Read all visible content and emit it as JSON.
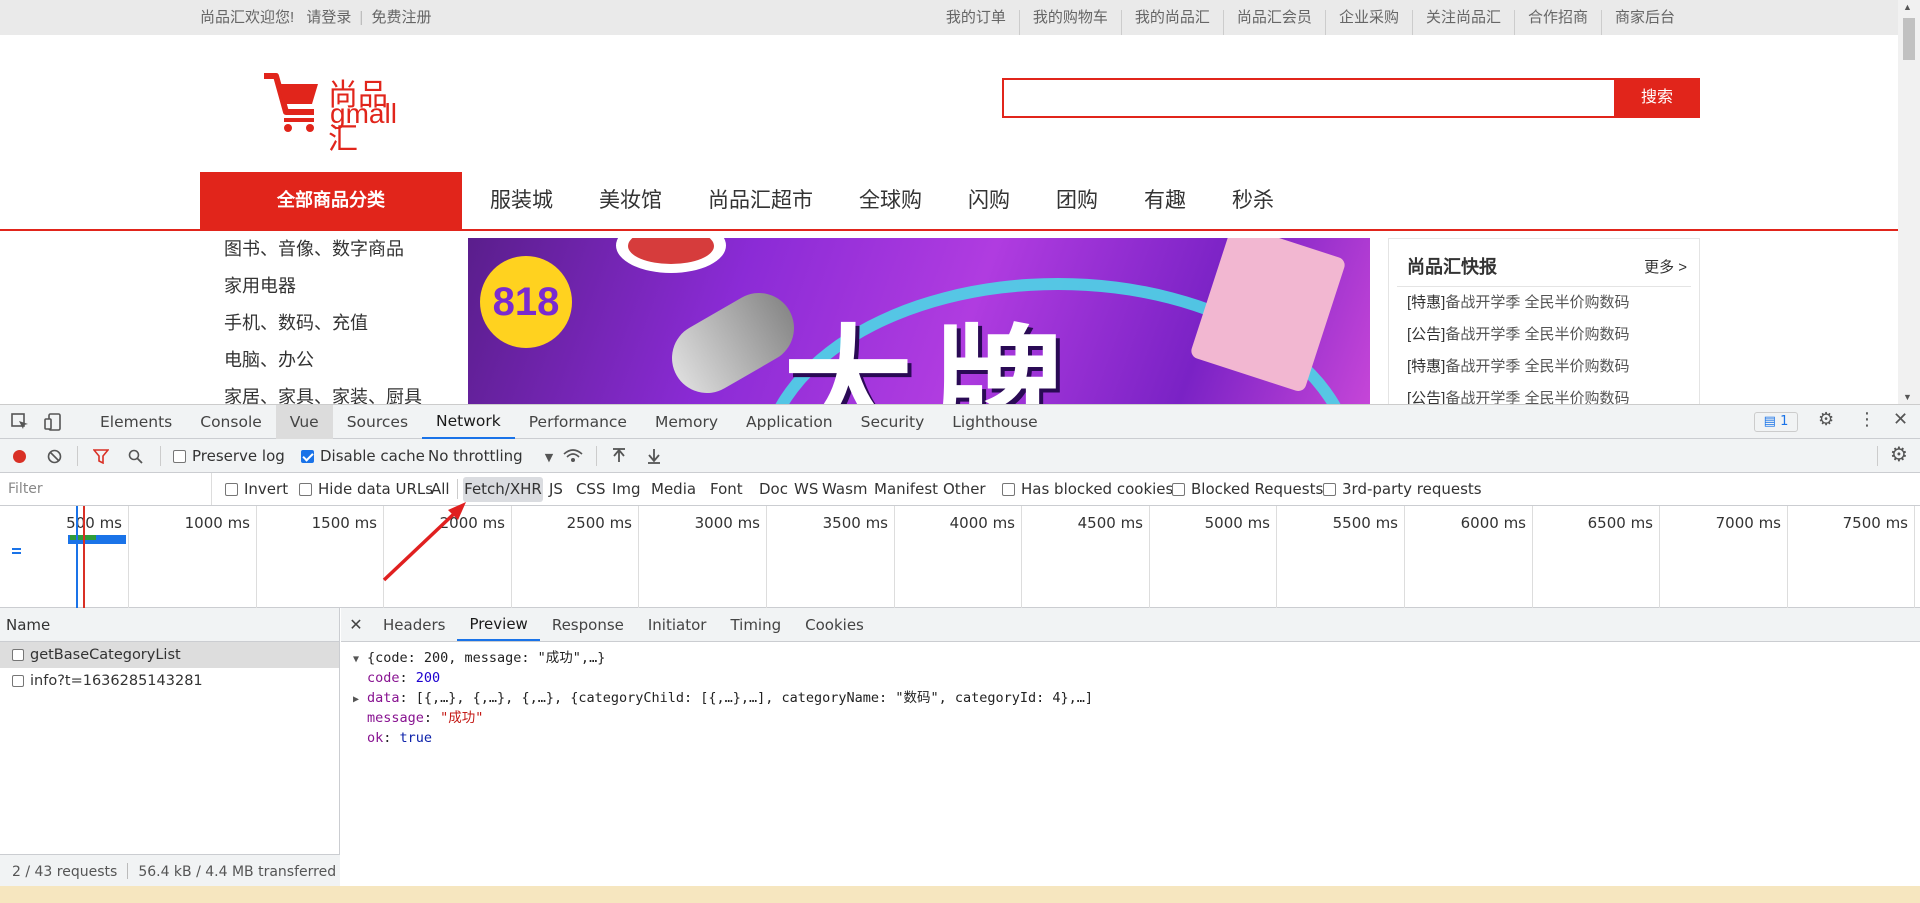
{
  "site": {
    "topbar": {
      "welcome": "尚品汇欢迎您!",
      "login": "请登录",
      "register": "免费注册",
      "links": [
        "我的订单",
        "我的购物车",
        "我的尚品汇",
        "尚品汇会员",
        "企业采购",
        "关注尚品汇",
        "合作招商",
        "商家后台"
      ]
    },
    "logo": {
      "cn": "尚品汇",
      "en": "gmall"
    },
    "search": {
      "value": "",
      "button": "搜索"
    },
    "nav": {
      "all_categories": "全部商品分类",
      "links": [
        "服装城",
        "美妆馆",
        "尚品汇超市",
        "全球购",
        "闪购",
        "团购",
        "有趣",
        "秒杀"
      ]
    },
    "categories": [
      "图书、音像、数字商品",
      "家用电器",
      "手机、数码、充值",
      "电脑、办公",
      "家居、家具、家装、厨具"
    ],
    "banner": {
      "badge": "818",
      "headline": "大牌"
    },
    "news": {
      "title": "尚品汇快报",
      "more": "更多 >",
      "items": [
        {
          "tag": "[特惠]",
          "text": "备战开学季 全民半价购数码"
        },
        {
          "tag": "[公告]",
          "text": "备战开学季 全民半价购数码"
        },
        {
          "tag": "[特惠]",
          "text": "备战开学季 全民半价购数码"
        },
        {
          "tag": "[公告]",
          "text": "备战开学季 全民半价购数码"
        }
      ]
    }
  },
  "devtools": {
    "tabs": [
      "Elements",
      "Console",
      "Vue",
      "Sources",
      "Network",
      "Performance",
      "Memory",
      "Application",
      "Security",
      "Lighthouse"
    ],
    "active_tab": "Network",
    "message_count": "1",
    "toolbar": {
      "preserve_log": "Preserve log",
      "disable_cache": "Disable cache",
      "throttling": "No throttling"
    },
    "filter": {
      "placeholder": "Filter",
      "invert": "Invert",
      "hide_data_urls": "Hide data URLs",
      "types": [
        "All",
        "Fetch/XHR",
        "JS",
        "CSS",
        "Img",
        "Media",
        "Font",
        "Doc",
        "WS",
        "Wasm",
        "Manifest",
        "Other"
      ],
      "active_type": "Fetch/XHR",
      "has_blocked_cookies": "Has blocked cookies",
      "blocked_requests": "Blocked Requests",
      "third_party": "3rd-party requests"
    },
    "timeline_labels": [
      "500 ms",
      "1000 ms",
      "1500 ms",
      "2000 ms",
      "2500 ms",
      "3000 ms",
      "3500 ms",
      "4000 ms",
      "4500 ms",
      "5000 ms",
      "5500 ms",
      "6000 ms",
      "6500 ms",
      "7000 ms",
      "7500 ms"
    ],
    "requests": {
      "header": "Name",
      "rows": [
        "getBaseCategoryList",
        "info?t=1636285143281"
      ],
      "summary_requests": "2 / 43 requests",
      "summary_transfer": "56.4 kB / 4.4 MB transferred"
    },
    "detail_tabs": [
      "Headers",
      "Preview",
      "Response",
      "Initiator",
      "Timing",
      "Cookies"
    ],
    "active_detail_tab": "Preview",
    "preview": {
      "line1": "{code: 200, message: \"成功\",…}",
      "code_key": "code",
      "code_val": "200",
      "data_key": "data",
      "data_val": "[{,…}, {,…}, {,…}, {categoryChild: [{,…},…], categoryName: \"数码\", categoryId: 4},…]",
      "message_key": "message",
      "message_val": "\"成功\"",
      "ok_key": "ok",
      "ok_val": "true"
    }
  }
}
